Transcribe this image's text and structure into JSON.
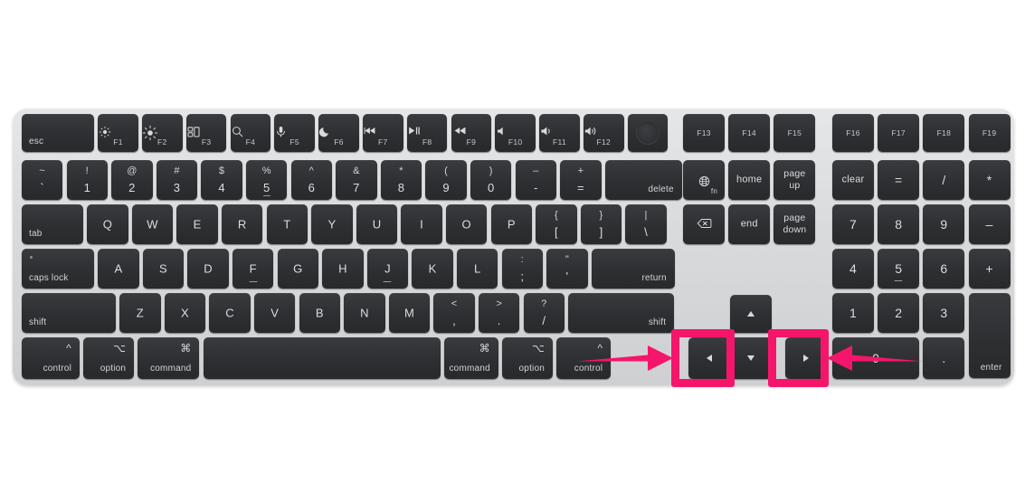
{
  "meta": {
    "subject": "Apple Magic Keyboard with Touch ID and Numeric Keypad",
    "accent_color": "#f5166b",
    "body_color": "#d9dadc",
    "key_color": "#2e2f32",
    "key_text_color": "#d7d8da",
    "background_color": "#ffffff"
  },
  "annotations": {
    "highlight_boxes": [
      {
        "name": "left-arrow-key-highlight",
        "target": "left-arrow-key",
        "color": "#f5166b"
      },
      {
        "name": "right-arrow-key-highlight",
        "target": "right-arrow-key",
        "color": "#f5166b"
      }
    ],
    "pointer_arrows": [
      {
        "name": "arrow-pointing-to-left-arrow-key",
        "direction": "right",
        "color": "#f5166b"
      },
      {
        "name": "arrow-pointing-to-right-arrow-key",
        "direction": "left",
        "color": "#f5166b"
      }
    ]
  },
  "keyboard": {
    "function_row": [
      {
        "name": "esc-key",
        "label": "esc",
        "style": "word-bottom-left"
      },
      {
        "name": "f1-key",
        "icon": "brightness-down-icon",
        "glyph": "☀",
        "label": "F1"
      },
      {
        "name": "f2-key",
        "icon": "brightness-up-icon",
        "glyph": "☀",
        "label": "F2"
      },
      {
        "name": "f3-key",
        "icon": "mission-control-icon",
        "glyph": "⊞",
        "label": "F3"
      },
      {
        "name": "f4-key",
        "icon": "spotlight-search-icon",
        "glyph": "⌕",
        "label": "F4"
      },
      {
        "name": "f5-key",
        "icon": "dictation-microphone-icon",
        "glyph": "☉",
        "label": "F5"
      },
      {
        "name": "f6-key",
        "icon": "do-not-disturb-moon-icon",
        "glyph": "☾",
        "label": "F6"
      },
      {
        "name": "f7-key",
        "icon": "rewind-icon",
        "glyph": "⏪",
        "label": "F7"
      },
      {
        "name": "f8-key",
        "icon": "play-pause-icon",
        "glyph": "⏯",
        "label": "F8"
      },
      {
        "name": "f9-key",
        "icon": "fast-forward-icon",
        "glyph": "⏩",
        "label": "F9"
      },
      {
        "name": "f10-key",
        "icon": "mute-icon",
        "glyph": "🔇",
        "label": "F10"
      },
      {
        "name": "f11-key",
        "icon": "volume-down-icon",
        "glyph": "🔈",
        "label": "F11"
      },
      {
        "name": "f12-key",
        "icon": "volume-up-icon",
        "glyph": "🔊",
        "label": "F12"
      },
      {
        "name": "touch-id-key",
        "icon": "touch-id-sensor-icon",
        "label": ""
      },
      {
        "name": "f13-key",
        "label": "F13"
      },
      {
        "name": "f14-key",
        "label": "F14"
      },
      {
        "name": "f15-key",
        "label": "F15"
      },
      {
        "name": "f16-key",
        "label": "F16"
      },
      {
        "name": "f17-key",
        "label": "F17"
      },
      {
        "name": "f18-key",
        "label": "F18"
      },
      {
        "name": "f19-key",
        "label": "F19"
      }
    ],
    "number_row": [
      {
        "name": "tilde-key",
        "upper": "~",
        "lower": "`"
      },
      {
        "name": "one-key",
        "upper": "!",
        "lower": "1"
      },
      {
        "name": "two-key",
        "upper": "@",
        "lower": "2"
      },
      {
        "name": "three-key",
        "upper": "#",
        "lower": "3"
      },
      {
        "name": "four-key",
        "upper": "$",
        "lower": "4"
      },
      {
        "name": "five-key",
        "upper": "%",
        "lower": "5"
      },
      {
        "name": "six-key",
        "upper": "^",
        "lower": "6"
      },
      {
        "name": "seven-key",
        "upper": "&",
        "lower": "7"
      },
      {
        "name": "eight-key",
        "upper": "*",
        "lower": "8"
      },
      {
        "name": "nine-key",
        "upper": "(",
        "lower": "9"
      },
      {
        "name": "zero-key",
        "upper": ")",
        "lower": "0"
      },
      {
        "name": "minus-key",
        "upper": "–",
        "lower": "-"
      },
      {
        "name": "equals-key",
        "upper": "+",
        "lower": "="
      },
      {
        "name": "delete-key",
        "label": "delete"
      }
    ],
    "top_letter_row": [
      {
        "name": "tab-key",
        "label": "tab"
      },
      {
        "name": "q-key",
        "label": "Q"
      },
      {
        "name": "w-key",
        "label": "W"
      },
      {
        "name": "e-key",
        "label": "E"
      },
      {
        "name": "r-key",
        "label": "R"
      },
      {
        "name": "t-key",
        "label": "T"
      },
      {
        "name": "y-key",
        "label": "Y"
      },
      {
        "name": "u-key",
        "label": "U"
      },
      {
        "name": "i-key",
        "label": "I"
      },
      {
        "name": "o-key",
        "label": "O"
      },
      {
        "name": "p-key",
        "label": "P"
      },
      {
        "name": "left-bracket-key",
        "upper": "{",
        "lower": "["
      },
      {
        "name": "right-bracket-key",
        "upper": "}",
        "lower": "]"
      },
      {
        "name": "backslash-key",
        "upper": "|",
        "lower": "\\"
      }
    ],
    "home_letter_row": [
      {
        "name": "caps-lock-key",
        "label": "caps lock"
      },
      {
        "name": "a-key",
        "label": "A"
      },
      {
        "name": "s-key",
        "label": "S"
      },
      {
        "name": "d-key",
        "label": "D"
      },
      {
        "name": "f-key",
        "label": "F"
      },
      {
        "name": "g-key",
        "label": "G"
      },
      {
        "name": "h-key",
        "label": "H"
      },
      {
        "name": "j-key",
        "label": "J"
      },
      {
        "name": "k-key",
        "label": "K"
      },
      {
        "name": "l-key",
        "label": "L"
      },
      {
        "name": "semicolon-key",
        "upper": ":",
        "lower": ";"
      },
      {
        "name": "quote-key",
        "upper": "\"",
        "lower": "'"
      },
      {
        "name": "return-key",
        "label": "return"
      }
    ],
    "bottom_letter_row": [
      {
        "name": "left-shift-key",
        "label": "shift"
      },
      {
        "name": "z-key",
        "label": "Z"
      },
      {
        "name": "x-key",
        "label": "X"
      },
      {
        "name": "c-key",
        "label": "C"
      },
      {
        "name": "v-key",
        "label": "V"
      },
      {
        "name": "b-key",
        "label": "B"
      },
      {
        "name": "n-key",
        "label": "N"
      },
      {
        "name": "m-key",
        "label": "M"
      },
      {
        "name": "comma-key",
        "upper": "<",
        "lower": ","
      },
      {
        "name": "period-key",
        "upper": ">",
        "lower": "."
      },
      {
        "name": "slash-key",
        "upper": "?",
        "lower": "/"
      },
      {
        "name": "right-shift-key",
        "label": "shift"
      }
    ],
    "modifier_row": [
      {
        "name": "left-control-key",
        "glyph": "^",
        "label": "control"
      },
      {
        "name": "left-option-key",
        "glyph": "⌥",
        "label": "option"
      },
      {
        "name": "left-command-key",
        "glyph": "⌘",
        "label": "command"
      },
      {
        "name": "space-bar",
        "label": ""
      },
      {
        "name": "right-command-key",
        "glyph": "⌘",
        "label": "command"
      },
      {
        "name": "right-option-key",
        "glyph": "⌥",
        "label": "option"
      },
      {
        "name": "right-control-key",
        "glyph": "^",
        "label": "control"
      }
    ],
    "navigation_cluster": [
      {
        "name": "fn-globe-key",
        "icon": "globe-icon",
        "label": "fn"
      },
      {
        "name": "home-key",
        "label": "home"
      },
      {
        "name": "page-up-key",
        "label": "page\nup"
      },
      {
        "name": "forward-delete-key",
        "icon": "forward-delete-icon",
        "label": ""
      },
      {
        "name": "end-key",
        "label": "end"
      },
      {
        "name": "page-down-key",
        "label": "page\ndown"
      }
    ],
    "arrow_cluster": [
      {
        "name": "up-arrow-key",
        "icon": "arrow-up-icon",
        "label": "▲"
      },
      {
        "name": "left-arrow-key",
        "icon": "arrow-left-icon",
        "label": "◀",
        "highlighted": true
      },
      {
        "name": "down-arrow-key",
        "icon": "arrow-down-icon",
        "label": "▼"
      },
      {
        "name": "right-arrow-key",
        "icon": "arrow-right-icon",
        "label": "▶",
        "highlighted": true
      }
    ],
    "numeric_keypad": [
      {
        "name": "clear-key",
        "label": "clear"
      },
      {
        "name": "keypad-equals-key",
        "label": "="
      },
      {
        "name": "keypad-divide-key",
        "label": "/"
      },
      {
        "name": "keypad-multiply-key",
        "label": "*"
      },
      {
        "name": "keypad-7-key",
        "label": "7"
      },
      {
        "name": "keypad-8-key",
        "label": "8"
      },
      {
        "name": "keypad-9-key",
        "label": "9"
      },
      {
        "name": "keypad-minus-key",
        "label": "–"
      },
      {
        "name": "keypad-4-key",
        "label": "4"
      },
      {
        "name": "keypad-5-key",
        "label": "5"
      },
      {
        "name": "keypad-6-key",
        "label": "6"
      },
      {
        "name": "keypad-plus-key",
        "label": "+"
      },
      {
        "name": "keypad-1-key",
        "label": "1"
      },
      {
        "name": "keypad-2-key",
        "label": "2"
      },
      {
        "name": "keypad-3-key",
        "label": "3"
      },
      {
        "name": "keypad-enter-key",
        "label": "enter"
      },
      {
        "name": "keypad-0-key",
        "label": "0"
      },
      {
        "name": "keypad-decimal-key",
        "label": "."
      }
    ]
  }
}
